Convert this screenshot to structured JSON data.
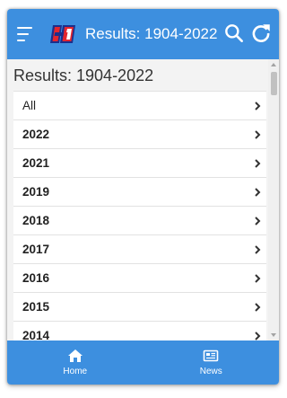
{
  "appbar": {
    "title": "Results: 1904-2022",
    "icons": [
      "menu-icon",
      "h1-logo",
      "search-icon",
      "refresh-icon"
    ]
  },
  "page": {
    "title": "Results: 1904-2022"
  },
  "list": {
    "items": [
      {
        "label": "All",
        "bold": false
      },
      {
        "label": "2022",
        "bold": true
      },
      {
        "label": "2021",
        "bold": true
      },
      {
        "label": "2019",
        "bold": true
      },
      {
        "label": "2018",
        "bold": true
      },
      {
        "label": "2017",
        "bold": true
      },
      {
        "label": "2016",
        "bold": true
      },
      {
        "label": "2015",
        "bold": true
      },
      {
        "label": "2014",
        "bold": true
      }
    ]
  },
  "bottom_nav": {
    "items": [
      {
        "label": "Home",
        "icon": "home-icon"
      },
      {
        "label": "News",
        "icon": "news-icon"
      }
    ]
  },
  "colors": {
    "accent": "#3d8fdf",
    "logo_red": "#e3262f",
    "logo_navy": "#1b2f8c"
  }
}
